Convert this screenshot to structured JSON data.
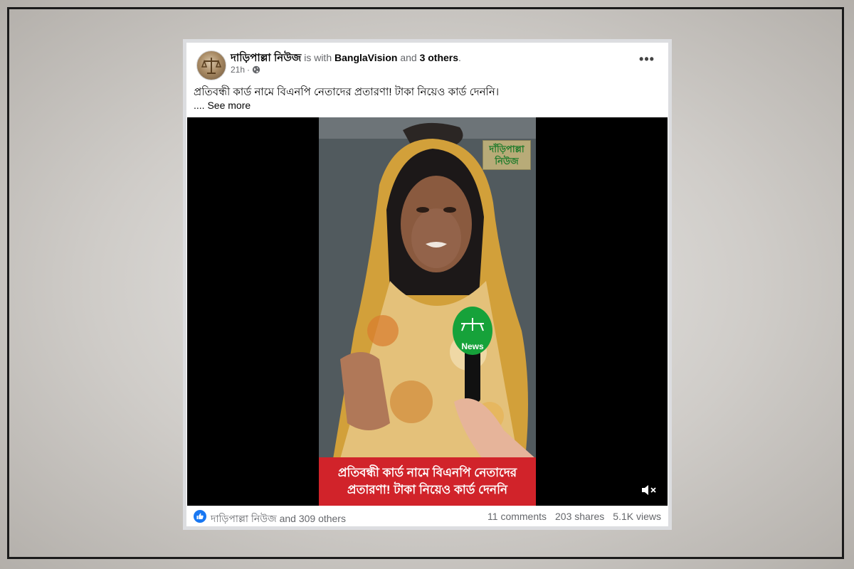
{
  "post": {
    "page_name": "দাড়িপাল্লা নিউজ",
    "with_text": "is with",
    "with_page": "BanglaVision",
    "and_text": "and",
    "others": "3 others",
    "period": ".",
    "time": "21h",
    "dot": "·",
    "audience_icon": "globe-icon",
    "more_icon": "more-options-icon",
    "more_label": "•••",
    "caption": "প্রতিবন্ধী কার্ড নামে বিএনপি নেতাদের প্রতারণা! টাকা নিয়েও কার্ড দেননি।",
    "see_more_prefix": "....",
    "see_more": "See more"
  },
  "video": {
    "watermark_line1": "দাঁড়িপাল্লা",
    "watermark_line2": "নিউজ",
    "mic_label": "News",
    "subtitle_line1": "প্রতিবন্ধী কার্ড নামে বিএনপি নেতাদের",
    "subtitle_line2": "প্রতারণা! টাকা নিয়েও কার্ড দেননি",
    "mute_icon": "speaker-muted-icon"
  },
  "footer": {
    "like_icon": "like-icon",
    "reactions": "দাড়িপাল্লা নিউজ and 309 others",
    "comments": "11 comments",
    "shares": "203 shares",
    "views": "5.1K views"
  },
  "colors": {
    "like_blue": "#1877f2",
    "subtitle_red": "#d1232a",
    "watermark_green": "#1d7a2a"
  }
}
